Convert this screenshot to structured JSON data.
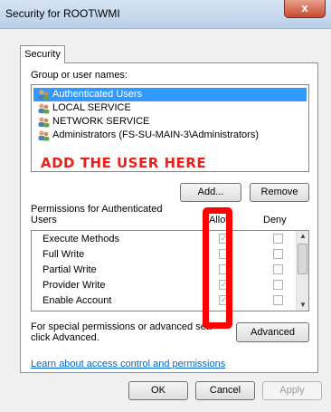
{
  "window": {
    "title": "Security for ROOT\\WMI",
    "close_glyph": "x"
  },
  "tabs": [
    {
      "label": "Security"
    }
  ],
  "group_label": "Group or user names:",
  "users": [
    {
      "name": "Authenticated Users",
      "selected": true
    },
    {
      "name": "LOCAL SERVICE",
      "selected": false
    },
    {
      "name": "NETWORK SERVICE",
      "selected": false
    },
    {
      "name": "Administrators (FS-SU-MAIN-3\\Administrators)",
      "selected": false
    }
  ],
  "annotation": "ADD THE USER HERE",
  "buttons": {
    "add": "Add...",
    "remove": "Remove",
    "advanced": "Advanced",
    "ok": "OK",
    "cancel": "Cancel",
    "apply": "Apply"
  },
  "permissions": {
    "title_line1": "Permissions for Authenticated",
    "title_line2": "Users",
    "allow_header": "Allow",
    "deny_header": "Deny",
    "rows": [
      {
        "name": "Execute Methods",
        "allow": true,
        "deny": false
      },
      {
        "name": "Full Write",
        "allow": false,
        "deny": false
      },
      {
        "name": "Partial Write",
        "allow": false,
        "deny": false
      },
      {
        "name": "Provider Write",
        "allow": true,
        "deny": false
      },
      {
        "name": "Enable Account",
        "allow": true,
        "deny": false
      }
    ]
  },
  "special_text_line1": "For special permissions or advanced sett",
  "special_text_line2": "click Advanced.",
  "learn_link": "Learn about access control and permissions",
  "colors": {
    "selection": "#3399ff",
    "annotation": "#e8211c",
    "highlight_box": "#ff0000"
  }
}
